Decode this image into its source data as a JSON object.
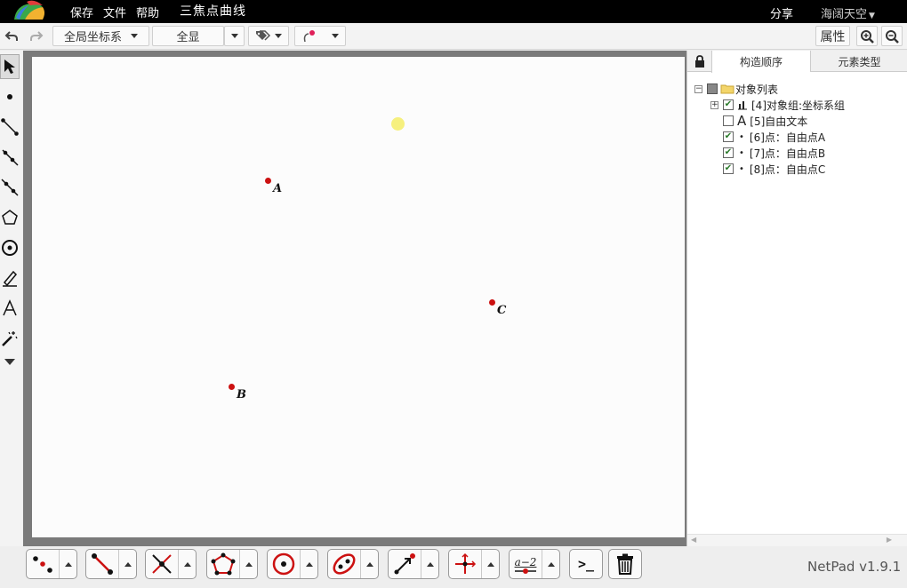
{
  "menu": {
    "save": "保存",
    "file": "文件",
    "help": "帮助",
    "title": "三焦点曲线",
    "share": "分享",
    "user": "海阔天空"
  },
  "toolbar": {
    "coord_system": "全局坐标系",
    "show_all": "全显",
    "properties": "属性"
  },
  "canvas": {
    "points": [
      {
        "label": "A"
      },
      {
        "label": "B"
      },
      {
        "label": "C"
      }
    ]
  },
  "panel": {
    "tab_order": "构造顺序",
    "tab_types": "元素类型",
    "tree": {
      "root": "对象列表",
      "items": [
        {
          "text": "[4]对象组:坐标系组",
          "checked": true
        },
        {
          "text": "[5]自由文本",
          "checked": false
        },
        {
          "text": "[6]点：自由点A",
          "checked": true
        },
        {
          "text": "[7]点：自由点B",
          "checked": true
        },
        {
          "text": "[8]点：自由点C",
          "checked": true
        }
      ]
    }
  },
  "bottom": {
    "algebra_label": "a−2",
    "console_label": ">_",
    "version": "NetPad v1.9.1"
  },
  "colors": {
    "point": "#cc1111",
    "highlight": "#f5ee70",
    "canvas_frame": "#7a7a7a",
    "topbar": "#000000"
  }
}
